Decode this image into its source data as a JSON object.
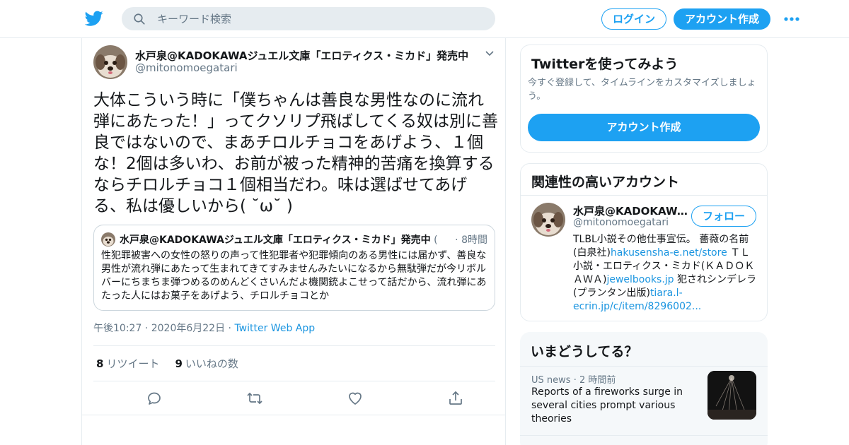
{
  "header": {
    "search_placeholder": "キーワード検索",
    "login_label": "ログイン",
    "signup_label": "アカウント作成",
    "brand_color": "#1da1f2"
  },
  "tweet": {
    "author_name": "水戸泉@KADOKAWAジュエル文庫「エロティクス・ミカド」発売中",
    "author_handle": "@mitonomoegatari",
    "text": "大体こういう時に「僕ちゃんは善良な男性なのに流れ弾にあたった！」ってクソリプ飛ばしてくる奴は別に善良ではないので、まあチロルチョコをあげよう、１個な！2個は多いわ、お前が被った精神的苦痛を換算するならチロルチョコ１個相当だわ。味は選ばせてあげる、私は優しいから( ˘ω˘ )",
    "quote": {
      "author_name": "水戸泉@KADOKAWAジュエル文庫「エロティクス・ミカド」発売中",
      "author_handle_fragment": "(",
      "separator": "·",
      "time": "8時間",
      "text": "性犯罪被害への女性の怒りの声って性犯罪者や犯罪傾向のある男性には届かず、善良な男性が流れ弾にあたって生まれてきてすみませんみたいになるから無駄弾だが今リボルバーにちまちま弾つめるのめんどくさいんだよ機関銃よこせって話だから、流れ弾にあたった人にはお菓子をあげよう、チロルチョコとか"
    },
    "time": "午後10:27",
    "date": "2020年6月22日",
    "separator": "·",
    "source_app": "Twitter Web App",
    "retweet_count": "8",
    "retweet_label": "リツイート",
    "like_count": "9",
    "like_label": "いいねの数"
  },
  "sidebar": {
    "signup_card": {
      "title": "Twitterを使ってみよう",
      "subtitle": "今すぐ登録して、タイムラインをカスタマイズしましょう。",
      "button_label": "アカウント作成"
    },
    "related": {
      "title": "関連性の高いアカウント",
      "name": "水戸泉@KADOKAWAジュエル文庫「エロティクス・ミカド」発売中",
      "handle": "@mitonomoegatari",
      "follow_label": "フォロー",
      "bio_1": "TLBL小説その他仕事宣伝。 薔薇の名前(白泉社)",
      "bio_link_1": "hakusensha-e.net/store",
      "bio_2": " ＴＬ小説・エロティクス・ミカド(ＫＡＤＯＫＡＷＡ)",
      "bio_link_2": "jewelbooks.jp",
      "bio_3": " 犯されシンデレラ(プランタン出版)",
      "bio_link_3": "tiara.l-ecrin.jp/c/item/8296002..."
    },
    "trends": {
      "title": "いまどうしてる？",
      "item_category": "US news",
      "item_separator": "·",
      "item_time": "2 時間前",
      "item_text": "Reports of a fireworks surge in several cities prompt various theories"
    }
  }
}
